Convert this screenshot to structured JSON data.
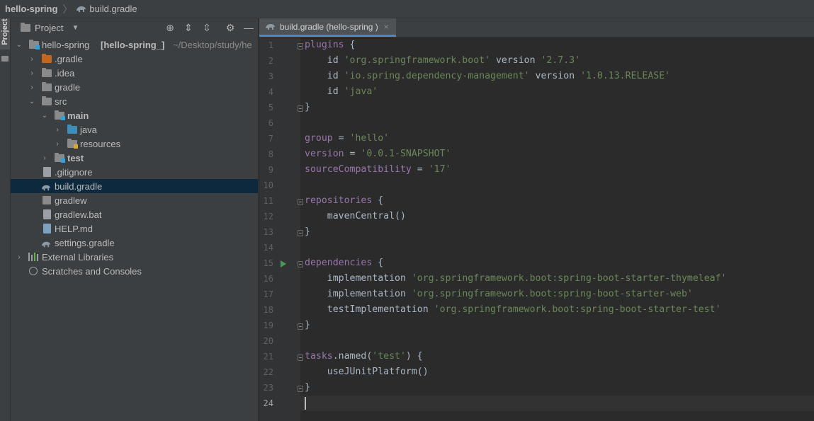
{
  "breadcrumb": {
    "project": "hello-spring",
    "file": "build.gradle"
  },
  "toolstrip": {
    "project_tab": "Project"
  },
  "project_panel": {
    "title": "Project",
    "tree": [
      {
        "label": "hello-spring",
        "extra": "[hello-spring_]",
        "path": "~/Desktop/study/he"
      },
      {
        "label": ".gradle"
      },
      {
        "label": ".idea"
      },
      {
        "label": "gradle"
      },
      {
        "label": "src"
      },
      {
        "label": "main"
      },
      {
        "label": "java"
      },
      {
        "label": "resources"
      },
      {
        "label": "test"
      },
      {
        "label": ".gitignore"
      },
      {
        "label": "build.gradle"
      },
      {
        "label": "gradlew"
      },
      {
        "label": "gradlew.bat"
      },
      {
        "label": "HELP.md"
      },
      {
        "label": "settings.gradle"
      },
      {
        "label": "External Libraries"
      },
      {
        "label": "Scratches and Consoles"
      }
    ]
  },
  "editor": {
    "tab_label": "build.gradle (hello-spring )",
    "tab_close": "×",
    "lines": [
      {
        "n": "1",
        "t": [
          [
            "plugins",
            "purple"
          ],
          [
            " {",
            "plain"
          ]
        ]
      },
      {
        "n": "2",
        "t": [
          [
            "    id ",
            "plain"
          ],
          [
            "'org.springframework.boot'",
            "str"
          ],
          [
            " version ",
            "plain"
          ],
          [
            "'2.7.3'",
            "str"
          ]
        ]
      },
      {
        "n": "3",
        "t": [
          [
            "    id ",
            "plain"
          ],
          [
            "'io.spring.dependency-management'",
            "str"
          ],
          [
            " version ",
            "plain"
          ],
          [
            "'1.0.13.RELEASE'",
            "str"
          ]
        ]
      },
      {
        "n": "4",
        "t": [
          [
            "    id ",
            "plain"
          ],
          [
            "'java'",
            "str"
          ]
        ]
      },
      {
        "n": "5",
        "t": [
          [
            "}",
            "plain"
          ]
        ]
      },
      {
        "n": "6",
        "t": []
      },
      {
        "n": "7",
        "t": [
          [
            "group",
            "purple"
          ],
          [
            " = ",
            "plain"
          ],
          [
            "'hello'",
            "str"
          ]
        ]
      },
      {
        "n": "8",
        "t": [
          [
            "version",
            "purple"
          ],
          [
            " = ",
            "plain"
          ],
          [
            "'0.0.1-SNAPSHOT'",
            "str"
          ]
        ]
      },
      {
        "n": "9",
        "t": [
          [
            "sourceCompatibility",
            "purple"
          ],
          [
            " = ",
            "plain"
          ],
          [
            "'17'",
            "str"
          ]
        ]
      },
      {
        "n": "10",
        "t": []
      },
      {
        "n": "11",
        "t": [
          [
            "repositories",
            "purple"
          ],
          [
            " {",
            "plain"
          ]
        ]
      },
      {
        "n": "12",
        "t": [
          [
            "    mavenCentral()",
            "plain"
          ]
        ]
      },
      {
        "n": "13",
        "t": [
          [
            "}",
            "plain"
          ]
        ]
      },
      {
        "n": "14",
        "t": []
      },
      {
        "n": "15",
        "t": [
          [
            "dependencies",
            "purple"
          ],
          [
            " {",
            "plain"
          ]
        ]
      },
      {
        "n": "16",
        "t": [
          [
            "    implementation ",
            "plain"
          ],
          [
            "'org.springframework.boot:spring-boot-starter-thymeleaf'",
            "str"
          ]
        ]
      },
      {
        "n": "17",
        "t": [
          [
            "    implementation ",
            "plain"
          ],
          [
            "'org.springframework.boot:spring-boot-starter-web'",
            "str"
          ]
        ]
      },
      {
        "n": "18",
        "t": [
          [
            "    testImplementation ",
            "plain"
          ],
          [
            "'org.springframework.boot:spring-boot-starter-test'",
            "str"
          ]
        ]
      },
      {
        "n": "19",
        "t": [
          [
            "}",
            "plain"
          ]
        ]
      },
      {
        "n": "20",
        "t": []
      },
      {
        "n": "21",
        "t": [
          [
            "tasks",
            "purple"
          ],
          [
            ".named(",
            "plain"
          ],
          [
            "'test'",
            "str"
          ],
          [
            ") {",
            "plain"
          ]
        ]
      },
      {
        "n": "22",
        "t": [
          [
            "    useJUnitPlatform()",
            "plain"
          ]
        ]
      },
      {
        "n": "23",
        "t": [
          [
            "}",
            "plain"
          ]
        ]
      },
      {
        "n": "24",
        "t": []
      }
    ]
  }
}
